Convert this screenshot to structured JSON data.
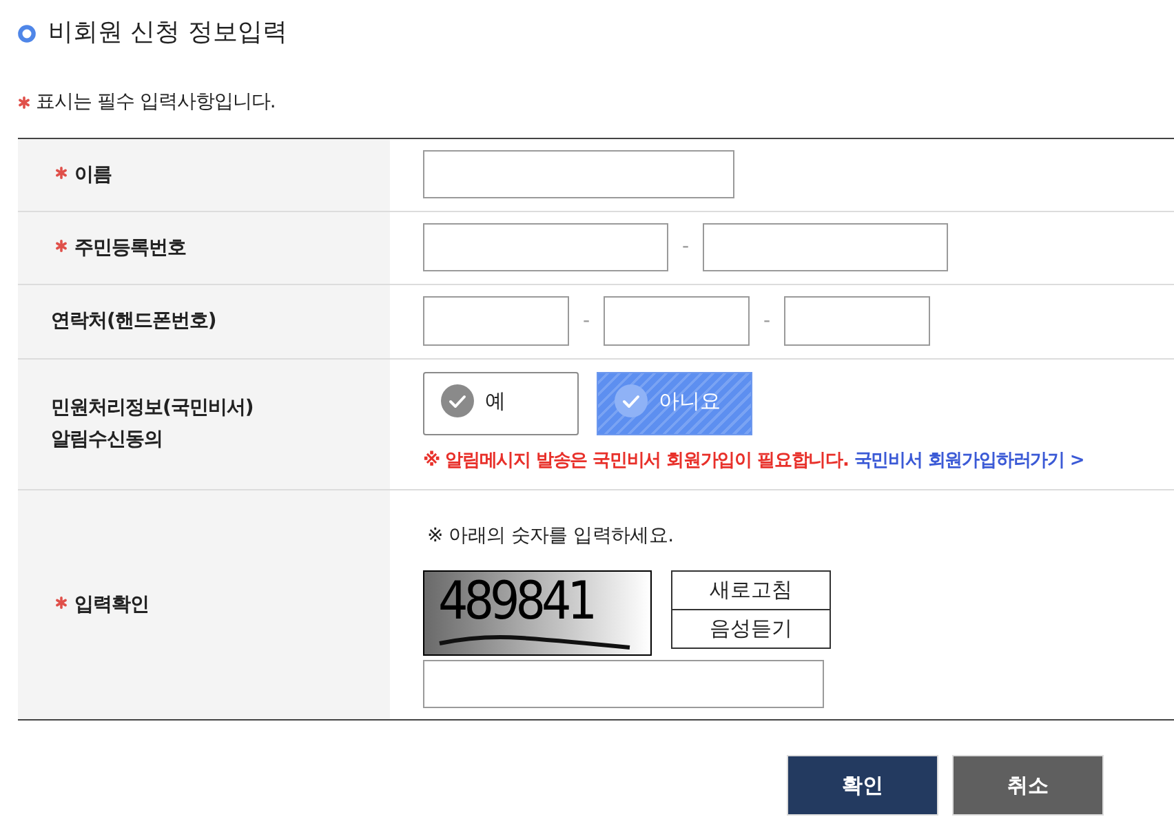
{
  "title": "비회원 신청 정보입력",
  "required_note": "표시는 필수 입력사항입니다.",
  "rows": [
    {
      "kind": "text",
      "label": [
        "이름"
      ],
      "required": true
    },
    {
      "kind": "split",
      "label": [
        "주민등록번호"
      ],
      "required": true,
      "separators": [
        "-"
      ]
    },
    {
      "kind": "split",
      "label": [
        "연락처(핸드폰번호)"
      ],
      "required": false,
      "separators": [
        "-",
        "-"
      ]
    },
    {
      "kind": "choice",
      "label": [
        "민원처리정보(국민비서)",
        "알림수신동의"
      ],
      "required": false,
      "options": [
        {
          "label": "예",
          "selected": false
        },
        {
          "label": "아니요",
          "selected": true
        }
      ],
      "warning": "※ 알림메시지 발송은 국민비서 회원가입이 필요합니다.",
      "link": "국민비서 회원가입하러가기 >"
    },
    {
      "kind": "captcha",
      "label": [
        "입력확인"
      ],
      "required": true,
      "instruction": "※ 아래의 숫자를 입력하세요.",
      "code": "489841",
      "buttons": [
        "새로고침",
        "음성듣기"
      ]
    }
  ],
  "actions": [
    {
      "label": "확인",
      "kind": "primary"
    },
    {
      "label": "취소",
      "kind": "secondary"
    }
  ]
}
